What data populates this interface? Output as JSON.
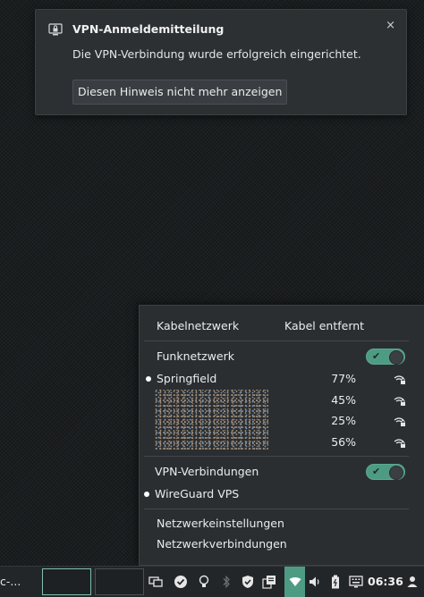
{
  "notification": {
    "title": "VPN-Anmeldemitteilung",
    "body": "Die VPN-Verbindung wurde erfolgreich eingerichtet.",
    "button_label": "Diesen Hinweis nicht mehr anzeigen",
    "close_glyph": "×",
    "icon": "lock-screen-icon"
  },
  "network_menu": {
    "wired": {
      "label": "Kabelnetzwerk",
      "status": "Kabel entfernt"
    },
    "wireless": {
      "label": "Funknetzwerk",
      "enabled": true,
      "networks": [
        {
          "name": "Springfield",
          "signal": "77%",
          "connected": true
        },
        {
          "name": "",
          "signal": "45%",
          "connected": false
        },
        {
          "name": "",
          "signal": "25%",
          "connected": false
        },
        {
          "name": "",
          "signal": "56%",
          "connected": false
        }
      ]
    },
    "vpn": {
      "label": "VPN-Verbindungen",
      "enabled": true,
      "connections": [
        {
          "name": "WireGuard VPS",
          "active": true
        }
      ]
    },
    "settings_label": "Netzwerkeinstellungen",
    "connections_label": "Netzwerkverbindungen",
    "toggle_glyph": "✔",
    "accent_color": "#4e9b83"
  },
  "taskbar": {
    "task_label": "c-...",
    "clock": "06:36",
    "tray_icons": [
      "display-icon",
      "checkmark-circle-icon",
      "lightbulb-icon",
      "bluetooth-icon",
      "shield-check-icon",
      "clipboard-icon",
      "network-wifi-icon",
      "volume-icon",
      "battery-icon",
      "keyboard-icon",
      "user-icon"
    ]
  }
}
